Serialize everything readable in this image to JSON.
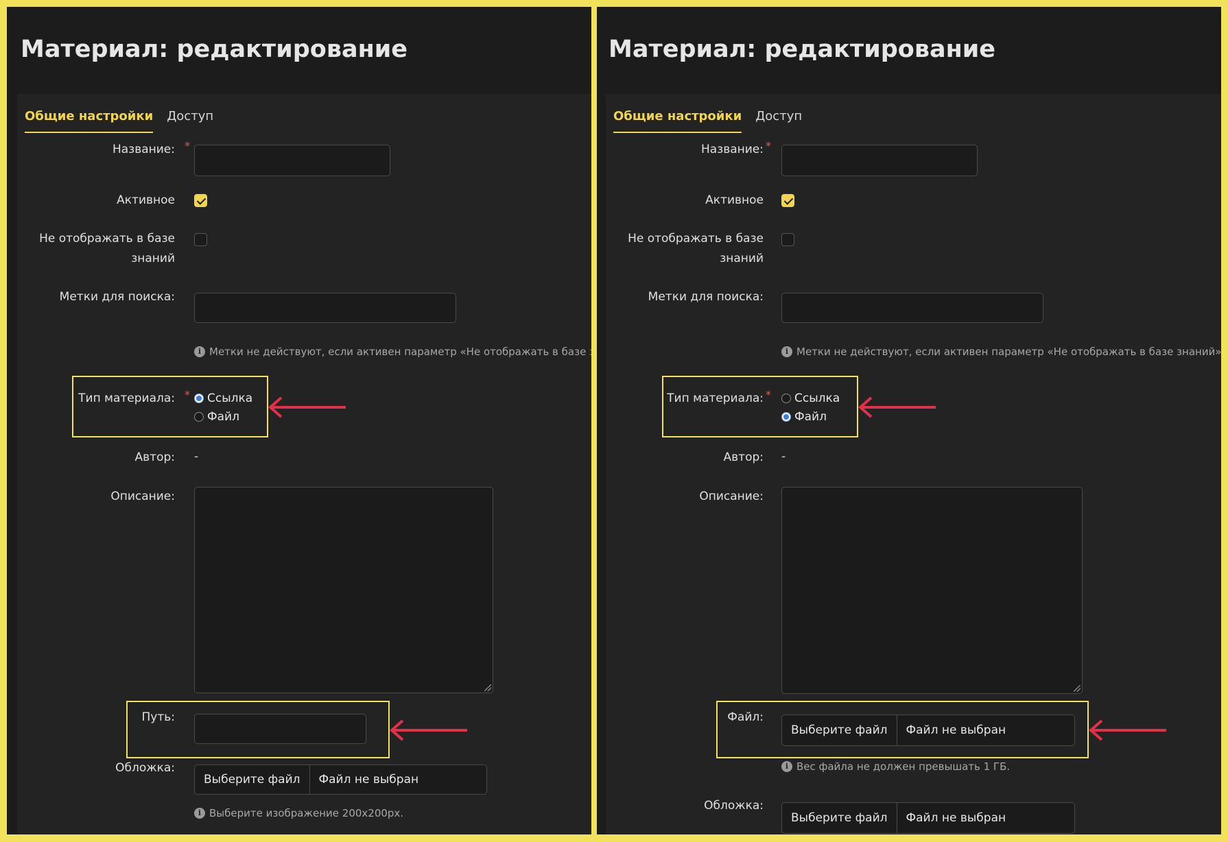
{
  "panels": [
    {
      "title": "Материал: редактирование",
      "tabs": [
        {
          "label": "Общие настройки",
          "active": true
        },
        {
          "label": "Доступ",
          "active": false
        }
      ],
      "fields": {
        "name_label": "Название:",
        "active_label": "Активное",
        "active_checked": true,
        "hide_label_line1": "Не отображать в базе",
        "hide_label_line2": "знаний",
        "hide_checked": false,
        "tags_label": "Метки для поиска:",
        "tags_hint": "Метки не действуют, если активен параметр «Не отображать в базе знаний».",
        "type_label": "Тип материала:",
        "type_options": [
          "Ссылка",
          "Файл"
        ],
        "type_selected": "Ссылка",
        "author_label": "Автор:",
        "author_value": "-",
        "description_label": "Описание:",
        "path_label": "Путь:",
        "cover_label": "Обложка:",
        "cover_button": "Выберите файл",
        "cover_status": "Файл не выбран",
        "cover_hint": "Выберите изображение 200x200px."
      }
    },
    {
      "title": "Материал: редактирование",
      "tabs": [
        {
          "label": "Общие настройки",
          "active": true
        },
        {
          "label": "Доступ",
          "active": false
        }
      ],
      "fields": {
        "name_label": "Название:",
        "active_label": "Активное",
        "active_checked": true,
        "hide_label_line1": "Не отображать в базе",
        "hide_label_line2": "знаний",
        "hide_checked": false,
        "tags_label": "Метки для поиска:",
        "tags_hint": "Метки не действуют, если активен параметр «Не отображать в базе знаний».",
        "type_label": "Тип материала:",
        "type_options": [
          "Ссылка",
          "Файл"
        ],
        "type_selected": "Файл",
        "author_label": "Автор:",
        "author_value": "-",
        "description_label": "Описание:",
        "file_label": "Файл:",
        "file_button": "Выберите файл",
        "file_status": "Файл не выбран",
        "file_hint": "Вес файла не должен превышать 1 ГБ.",
        "cover_label": "Обложка:",
        "cover_button": "Выберите файл",
        "cover_status": "Файл не выбран"
      }
    }
  ],
  "colors": {
    "frame": "#f1e15b",
    "panel_bg": "#1c1c1c",
    "card_bg": "#232323",
    "accent": "#f1d54e",
    "required": "#e05a5a",
    "arrow": "#e0304a"
  }
}
